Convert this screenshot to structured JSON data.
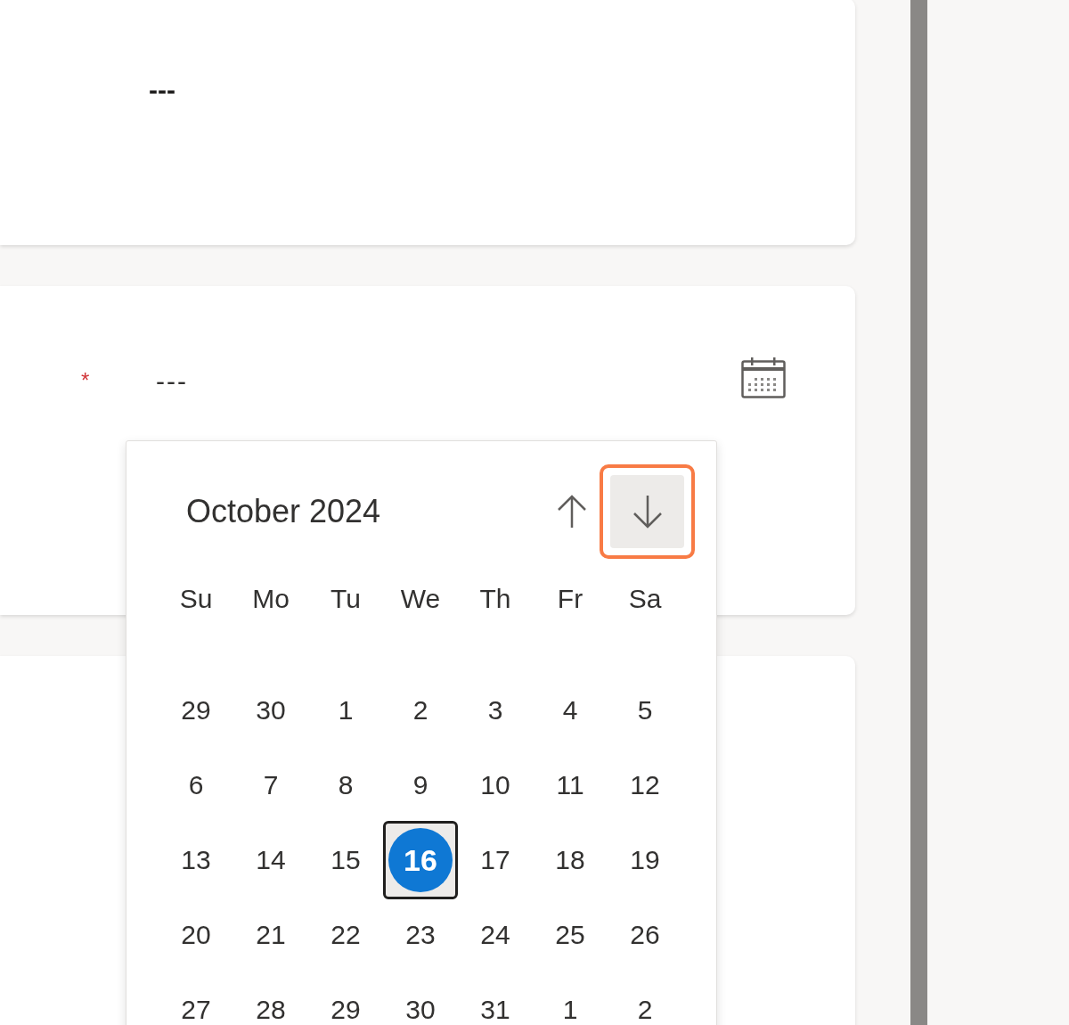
{
  "cards": [
    {
      "kind": "text",
      "value": "---"
    },
    {
      "kind": "date",
      "value": "---",
      "required_mark": "*"
    },
    {
      "kind": "empty"
    }
  ],
  "date_picker": {
    "title": "October 2024",
    "nav": [
      {
        "kind": "up",
        "highlighted": false
      },
      {
        "kind": "down",
        "highlighted": true
      }
    ],
    "weekdays": [
      "Su",
      "Mo",
      "Tu",
      "We",
      "Th",
      "Fr",
      "Sa"
    ],
    "weeks": [
      [
        {
          "day": "29",
          "selected": false
        },
        {
          "day": "30",
          "selected": false
        },
        {
          "day": "1",
          "selected": false
        },
        {
          "day": "2",
          "selected": false
        },
        {
          "day": "3",
          "selected": false
        },
        {
          "day": "4",
          "selected": false
        },
        {
          "day": "5",
          "selected": false
        }
      ],
      [
        {
          "day": "6",
          "selected": false
        },
        {
          "day": "7",
          "selected": false
        },
        {
          "day": "8",
          "selected": false
        },
        {
          "day": "9",
          "selected": false
        },
        {
          "day": "10",
          "selected": false
        },
        {
          "day": "11",
          "selected": false
        },
        {
          "day": "12",
          "selected": false
        }
      ],
      [
        {
          "day": "13",
          "selected": false
        },
        {
          "day": "14",
          "selected": false
        },
        {
          "day": "15",
          "selected": false
        },
        {
          "day": "16",
          "selected": true
        },
        {
          "day": "17",
          "selected": false
        },
        {
          "day": "18",
          "selected": false
        },
        {
          "day": "19",
          "selected": false
        }
      ],
      [
        {
          "day": "20",
          "selected": false
        },
        {
          "day": "21",
          "selected": false
        },
        {
          "day": "22",
          "selected": false
        },
        {
          "day": "23",
          "selected": false
        },
        {
          "day": "24",
          "selected": false
        },
        {
          "day": "25",
          "selected": false
        },
        {
          "day": "26",
          "selected": false
        }
      ],
      [
        {
          "day": "27",
          "selected": false
        },
        {
          "day": "28",
          "selected": false
        },
        {
          "day": "29",
          "selected": false
        },
        {
          "day": "30",
          "selected": false
        },
        {
          "day": "31",
          "selected": false
        },
        {
          "day": "1",
          "selected": false
        },
        {
          "day": "2",
          "selected": false
        }
      ]
    ]
  }
}
